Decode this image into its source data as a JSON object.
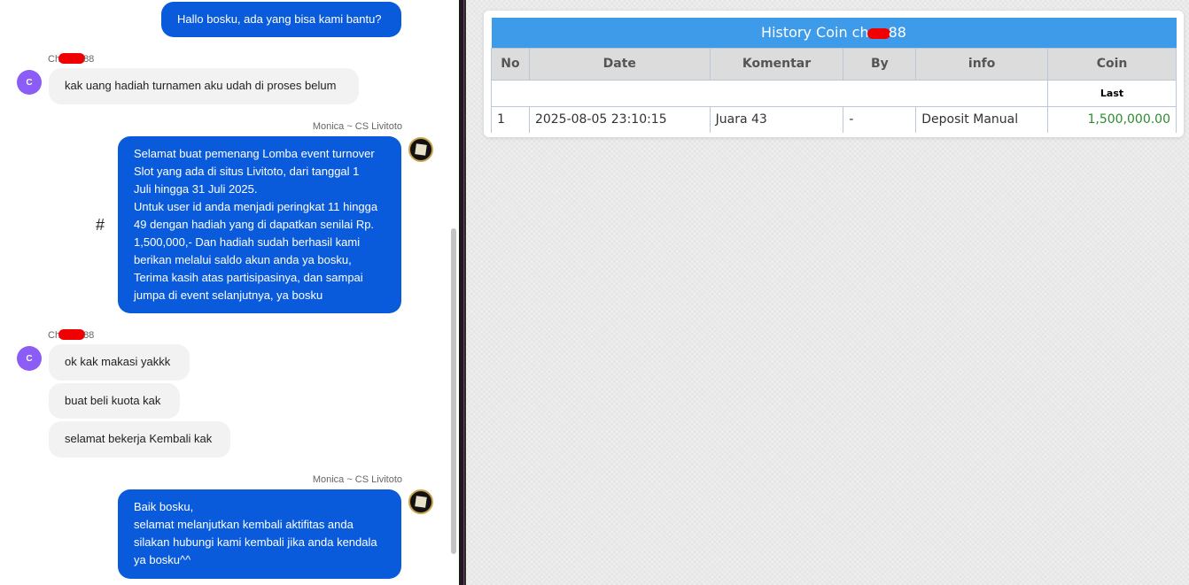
{
  "chat": {
    "greeting": "Hallo bosku, ada yang bisa kami bantu?",
    "user_name_prefix": "Ch",
    "user_name_suffix": "88",
    "user_avatar_letter": "C",
    "msg_user_1": "kak uang hadiah turnamen aku udah di proses belum",
    "agent_name_1": "Monica ~ CS Livitoto",
    "agent_msg_1": [
      "Selamat buat pemenang Lomba event turnover",
      "Slot yang ada di situs Livitoto, dari tanggal 1",
      "Juli hingga 31 Juli 2025.",
      "Untuk user id anda menjadi peringkat 11 hingga",
      "49 dengan hadiah yang di dapatkan senilai Rp.",
      "1,500,000,- Dan hadiah sudah berhasil kami",
      "berikan melalui saldo akun anda ya bosku,",
      "Terima kasih atas partisipasinya, dan sampai",
      "jumpa di event selanjutnya, ya bosku"
    ],
    "hash_mark": "#",
    "msg_user_2": "ok kak makasi yakkk",
    "msg_user_3": "buat beli kuota kak",
    "msg_user_4": "selamat bekerja Kembali kak",
    "agent_name_2": "Monica ~ CS Livitoto",
    "agent_msg_2": [
      "Baik bosku,",
      "selamat melanjutkan kembali aktifitas anda",
      "silakan hubungi kami kembali jika anda kendala",
      "ya bosku^^"
    ]
  },
  "history": {
    "title_prefix": "History Coin ch",
    "title_suffix": "88",
    "columns": [
      "No",
      "Date",
      "Komentar",
      "By",
      "info",
      "Coin"
    ],
    "sub_label": "Last",
    "rows": [
      {
        "no": "1",
        "date": "2025-08-05 23:10:15",
        "komentar": "Juara 43",
        "by": "-",
        "info": "Deposit Manual",
        "coin": "1,500,000.00"
      }
    ]
  },
  "colors": {
    "outgoing_bubble": "#0a5bdc",
    "incoming_bubble": "#f2f2f3",
    "table_title_bg": "#3d9be9",
    "coin_text": "#2e8b2e",
    "avatar_purple": "#8b5cf6"
  }
}
